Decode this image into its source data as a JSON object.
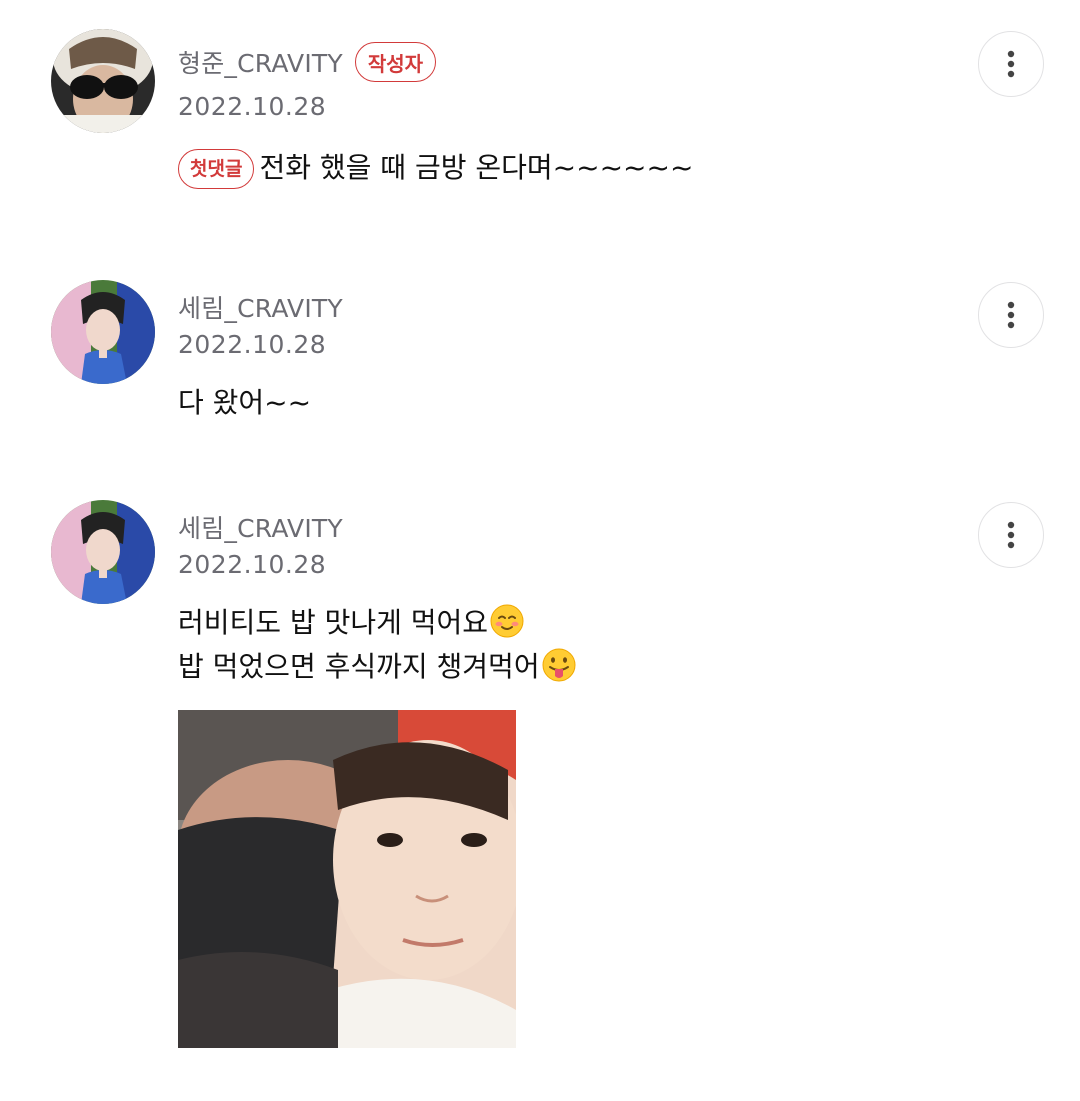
{
  "comments": [
    {
      "author": "형준_CRAVITY",
      "writer_badge": "작성자",
      "date": "2022.10.28",
      "first_badge": "첫댓글",
      "text": "전화 했을 때 금방 온다며~~~~~~",
      "more_icon": "more-vertical-icon"
    },
    {
      "author": "세림_CRAVITY",
      "date": "2022.10.28",
      "text": "다 왔어~~",
      "more_icon": "more-vertical-icon"
    },
    {
      "author": "세림_CRAVITY",
      "date": "2022.10.28",
      "lines": [
        "러비티도 밥 맛나게 먹어요",
        "밥 먹었으면 후식까지 챙겨먹어"
      ],
      "emojis": [
        "smiling-blush-emoji",
        "tongue-out-emoji"
      ],
      "more_icon": "more-vertical-icon",
      "attachment": "photo"
    }
  ],
  "colors": {
    "badge_red": "#d23a3a",
    "meta_gray": "#6b6b72",
    "text": "#111111"
  }
}
